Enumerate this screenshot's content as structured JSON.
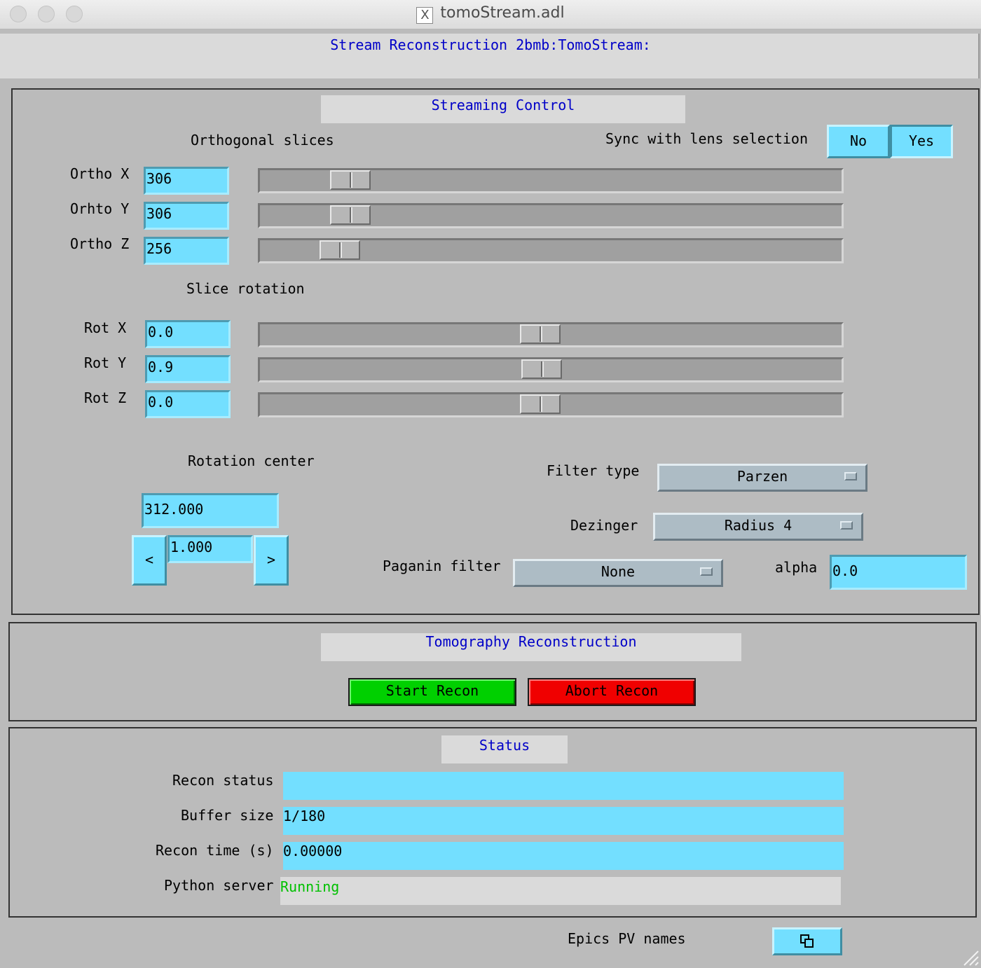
{
  "window": {
    "title": "tomoStream.adl",
    "x_icon": "X"
  },
  "header": {
    "title": "Stream Reconstruction 2bmb:TomoStream:"
  },
  "streaming": {
    "title": "Streaming Control",
    "ortho_heading": "Orthogonal slices",
    "sync_label": "Sync with lens selection",
    "sync_options": [
      "No",
      "Yes"
    ],
    "sync_selected": "Yes",
    "ortho": [
      {
        "label": "Ortho X",
        "value": "306",
        "slider_fraction": 0.13
      },
      {
        "label": "Orhto Y",
        "value": "306",
        "slider_fraction": 0.13
      },
      {
        "label": "Ortho Z",
        "value": "256",
        "slider_fraction": 0.11
      }
    ],
    "rotation_heading": "Slice rotation",
    "rot": [
      {
        "label": "Rot X",
        "value": "0.0",
        "slider_fraction": 0.48
      },
      {
        "label": "Rot Y",
        "value": "0.9",
        "slider_fraction": 0.483
      },
      {
        "label": "Rot Z",
        "value": "0.0",
        "slider_fraction": 0.48
      }
    ],
    "center_heading": "Rotation center",
    "center_value": "312.000",
    "center_step": "1.000",
    "decrement_label": "<",
    "increment_label": ">",
    "filter_label": "Filter type",
    "filter_value": "Parzen",
    "dezinger_label": "Dezinger",
    "dezinger_value": "Radius 4",
    "paganin_label": "Paganin filter",
    "paganin_value": "None",
    "alpha_label": "alpha",
    "alpha_value": "0.0"
  },
  "recon": {
    "title": "Tomography Reconstruction",
    "start_label": "Start Recon",
    "abort_label": "Abort Recon",
    "start_color": "#00d000",
    "abort_color": "#f00000"
  },
  "status": {
    "title": "Status",
    "rows": [
      {
        "label": "Recon status",
        "value": ""
      },
      {
        "label": "Buffer size",
        "value": "1/180"
      },
      {
        "label": "Recon time (s)",
        "value": "0.00000"
      },
      {
        "label": "Python server",
        "value": "Running"
      }
    ],
    "running_color": "#00c000"
  },
  "footer": {
    "pv_label": "Epics PV names",
    "pv_button_icon": "related-display-icon"
  }
}
